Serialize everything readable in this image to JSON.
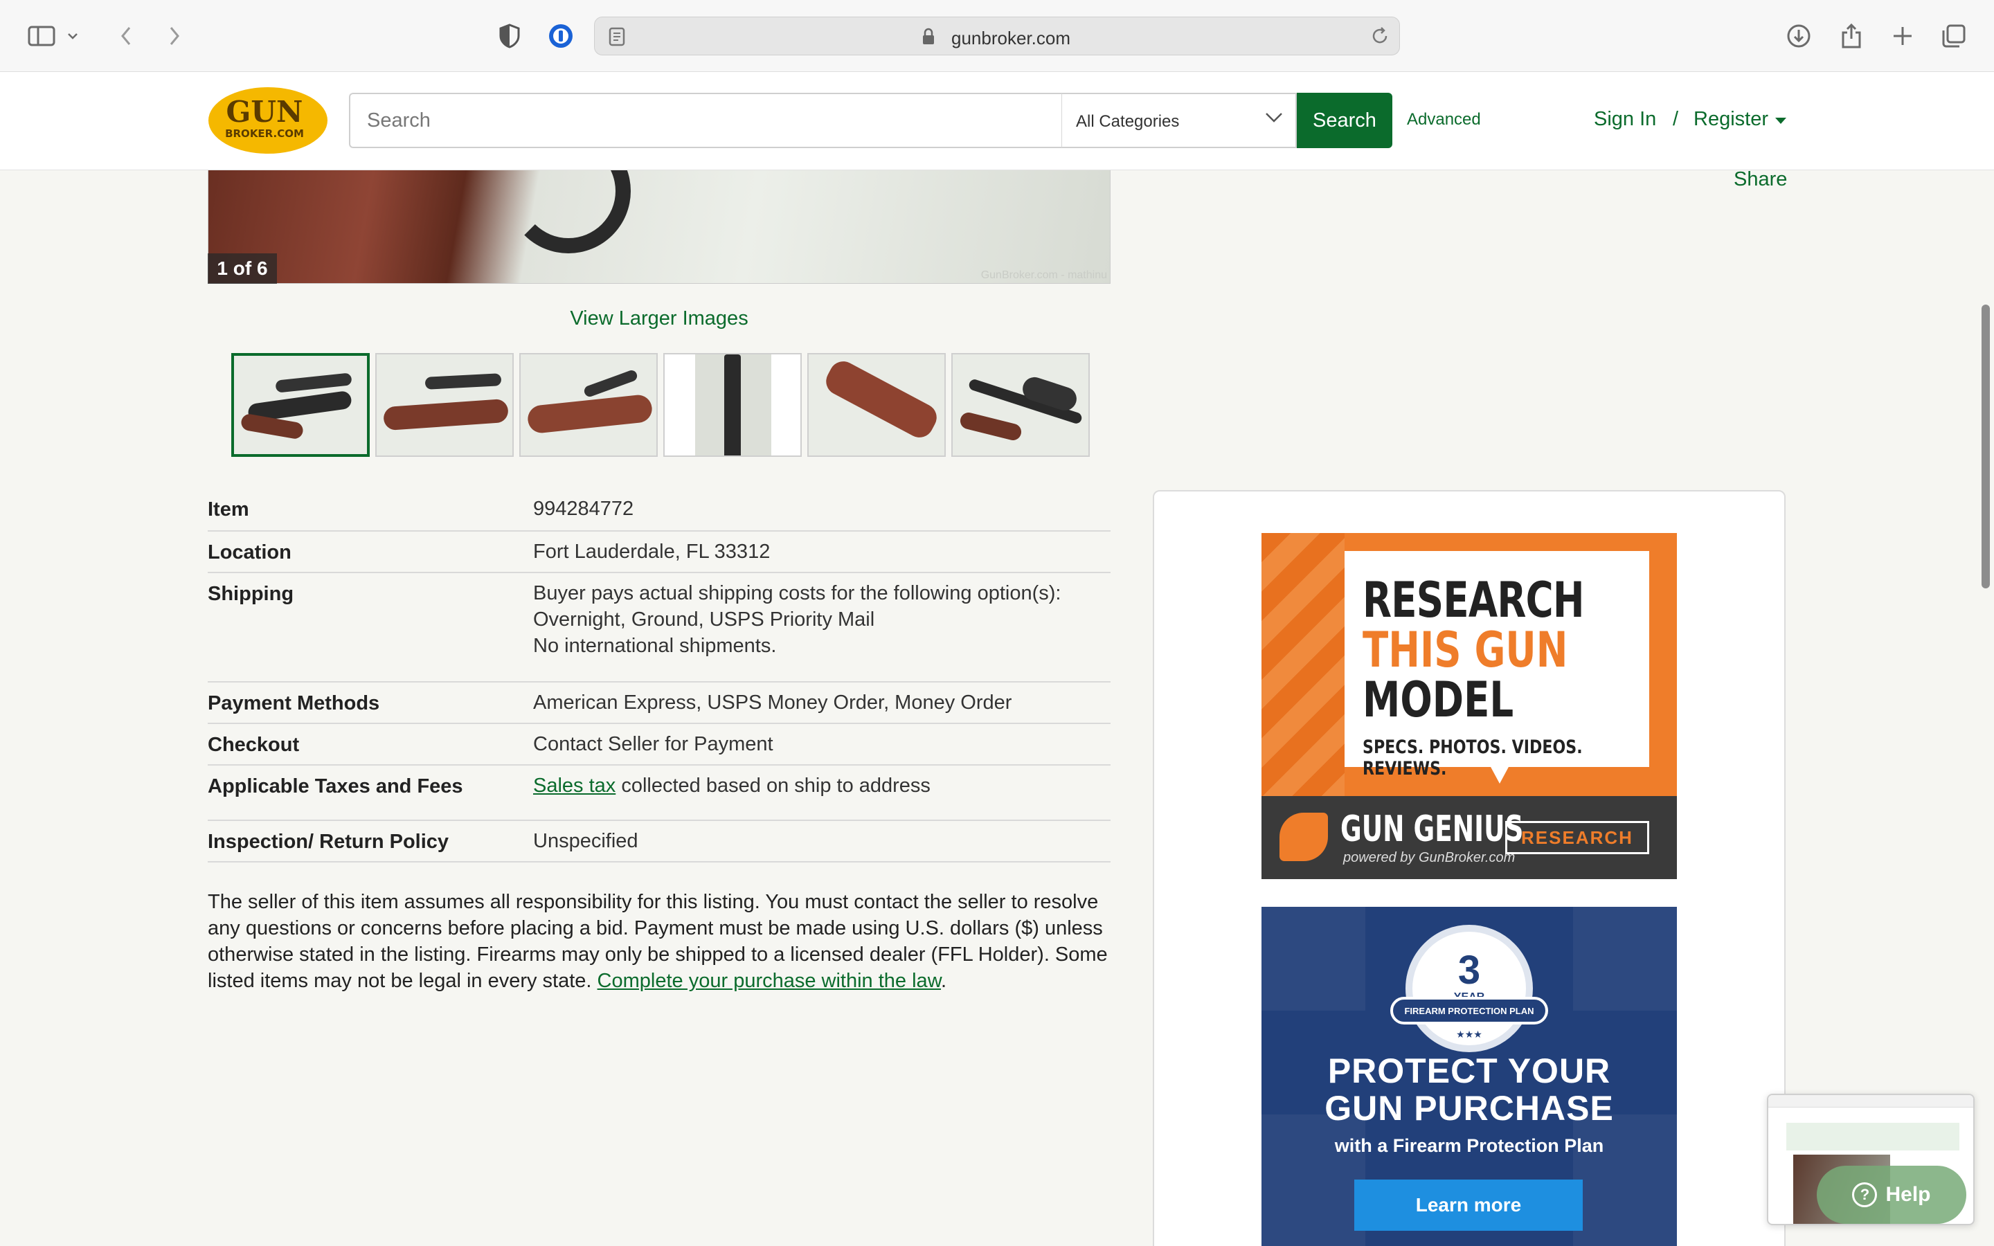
{
  "browser": {
    "url": "gunbroker.com"
  },
  "header": {
    "logo_top": "GUN",
    "logo_bottom": "BROKER.COM",
    "search_placeholder": "Search",
    "category": "All Categories",
    "search_button": "Search",
    "advanced": "Advanced",
    "sign_in": "Sign In",
    "separator": "/",
    "register": "Register"
  },
  "gallery": {
    "counter": "1 of 6",
    "watermark": "GunBroker.com - mathinu",
    "view_larger": "View Larger Images",
    "thumbnail_count": 6
  },
  "share": "Share",
  "details": [
    {
      "key": "Item",
      "value": "994284772"
    },
    {
      "key": "Location",
      "value": "Fort Lauderdale, FL 33312"
    },
    {
      "key": "Shipping",
      "value_lines": [
        "Buyer pays actual shipping costs for the following option(s):",
        "Overnight, Ground, USPS Priority Mail",
        "No international shipments."
      ]
    },
    {
      "key": "Payment Methods",
      "value": "American Express, USPS Money Order, Money Order"
    },
    {
      "key": "Checkout",
      "value": "Contact Seller for Payment"
    },
    {
      "key": "Applicable Taxes and Fees",
      "link": "Sales tax",
      "value": " collected based on ship to address"
    },
    {
      "key": "Inspection/ Return Policy",
      "value": "Unspecified"
    }
  ],
  "disclaimer": {
    "text": "The seller of this item assumes all responsibility for this listing. You must contact the seller to resolve any questions or concerns before placing a bid. Payment must be made using U.S. dollars ($) unless otherwise stated in the listing. Firearms may only be shipped to a licensed dealer (FFL Holder). Some listed items may not be legal in every state. ",
    "link": "Complete your purchase within the law",
    "end": "."
  },
  "ads": {
    "research": {
      "line1": "RESEARCH",
      "line2": "THIS GUN",
      "line3": "MODEL",
      "tagline": "SPECS. PHOTOS. VIDEOS. REVIEWS.",
      "brand": "GUN GENIUS",
      "brand_sub": "powered by GunBroker.com",
      "button": "RESEARCH",
      "accent": "#ef7d2a"
    },
    "protection": {
      "badge_number": "3",
      "badge_year": "YEAR",
      "badge_ribbon": "FIREARM PROTECTION PLAN",
      "stars": "★★★",
      "headline1": "PROTECT YOUR",
      "headline2": "GUN PURCHASE",
      "subline": "with a Firearm Protection Plan",
      "button": "Learn more",
      "bg": "#22407a"
    }
  },
  "help": {
    "label": "Help",
    "icon": "question-icon"
  },
  "colors": {
    "brand_green": "#0b6b2c",
    "logo_yellow": "#f5b800"
  }
}
